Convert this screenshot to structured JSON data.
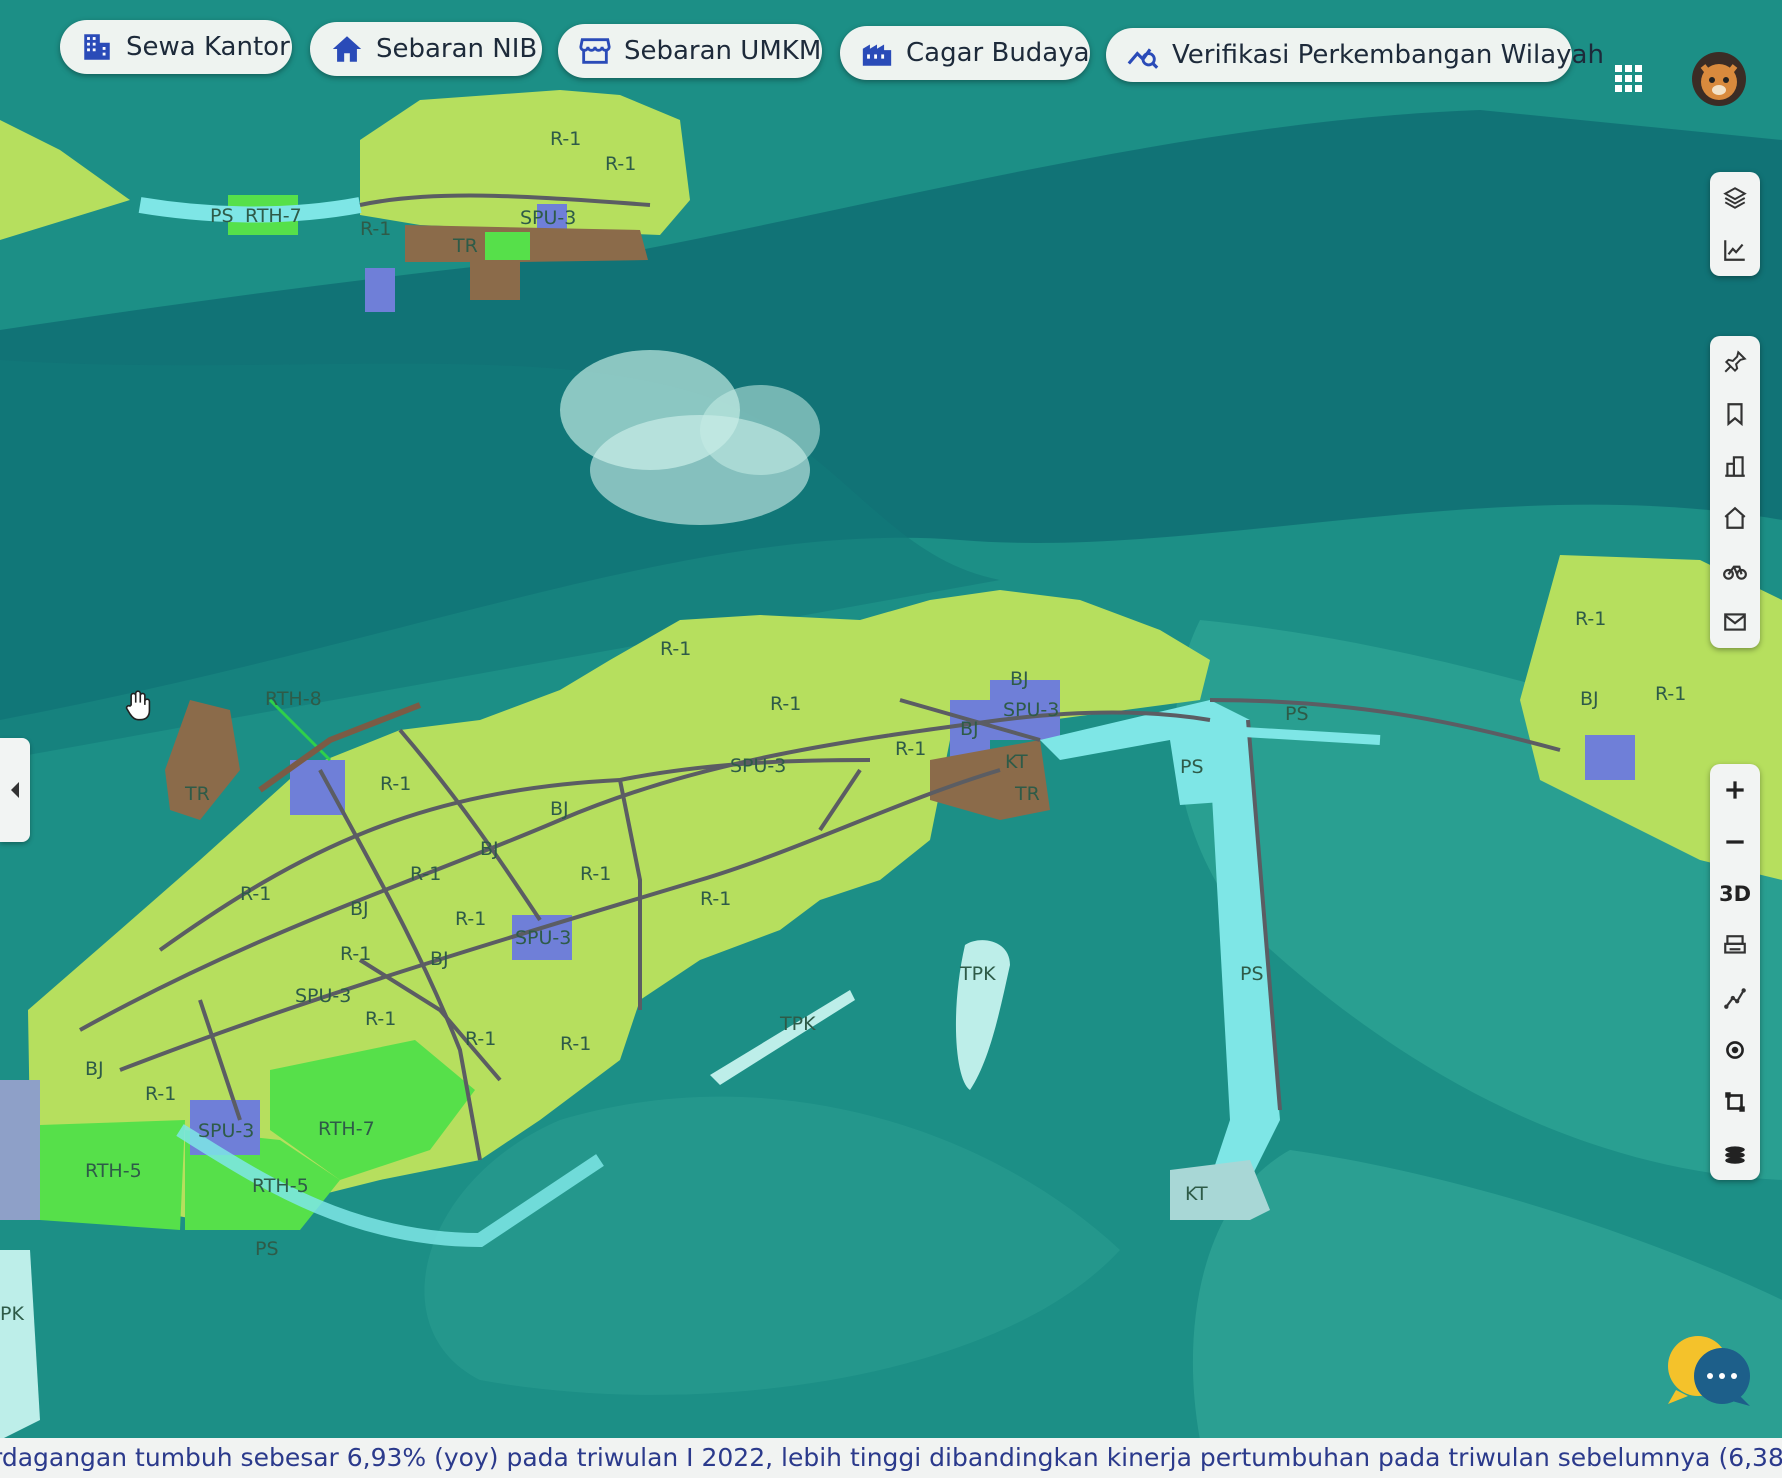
{
  "nav": {
    "sewa_kantor": "Sewa Kantor",
    "sebaran_nib": "Sebaran NIB",
    "sebaran_umkm": "Sebaran UMKM",
    "cagar_budaya": "Cagar Budaya",
    "verifikasi": "Verifikasi Perkembangan Wilayah"
  },
  "controls": {
    "three_d": "3D"
  },
  "ticker": {
    "text": "rdagangan tumbuh sebesar 6,93% (yoy) pada triwulan I 2022, lebih tinggi dibandingkan kinerja pertumbuhan pada triwulan sebelumnya (6,38%,"
  },
  "map": {
    "zone_labels": [
      "R-1",
      "BJ",
      "PS",
      "TR",
      "KT",
      "TPK",
      "SPU-3",
      "RTH-5",
      "RTH-7",
      "RTH-8",
      "PK"
    ],
    "colors": {
      "water": "#1c8f86",
      "deep_water": "#0f6f73",
      "shallow": "#3aa99a",
      "zone_r1": "#b6df5e",
      "zone_rth": "#56e04a",
      "zone_spu": "#6f7fd8",
      "zone_tr": "#8b6b4a",
      "zone_ps": "#7ee6e6",
      "zone_tpk": "#bdeee9",
      "road": "#5b5d63"
    }
  }
}
